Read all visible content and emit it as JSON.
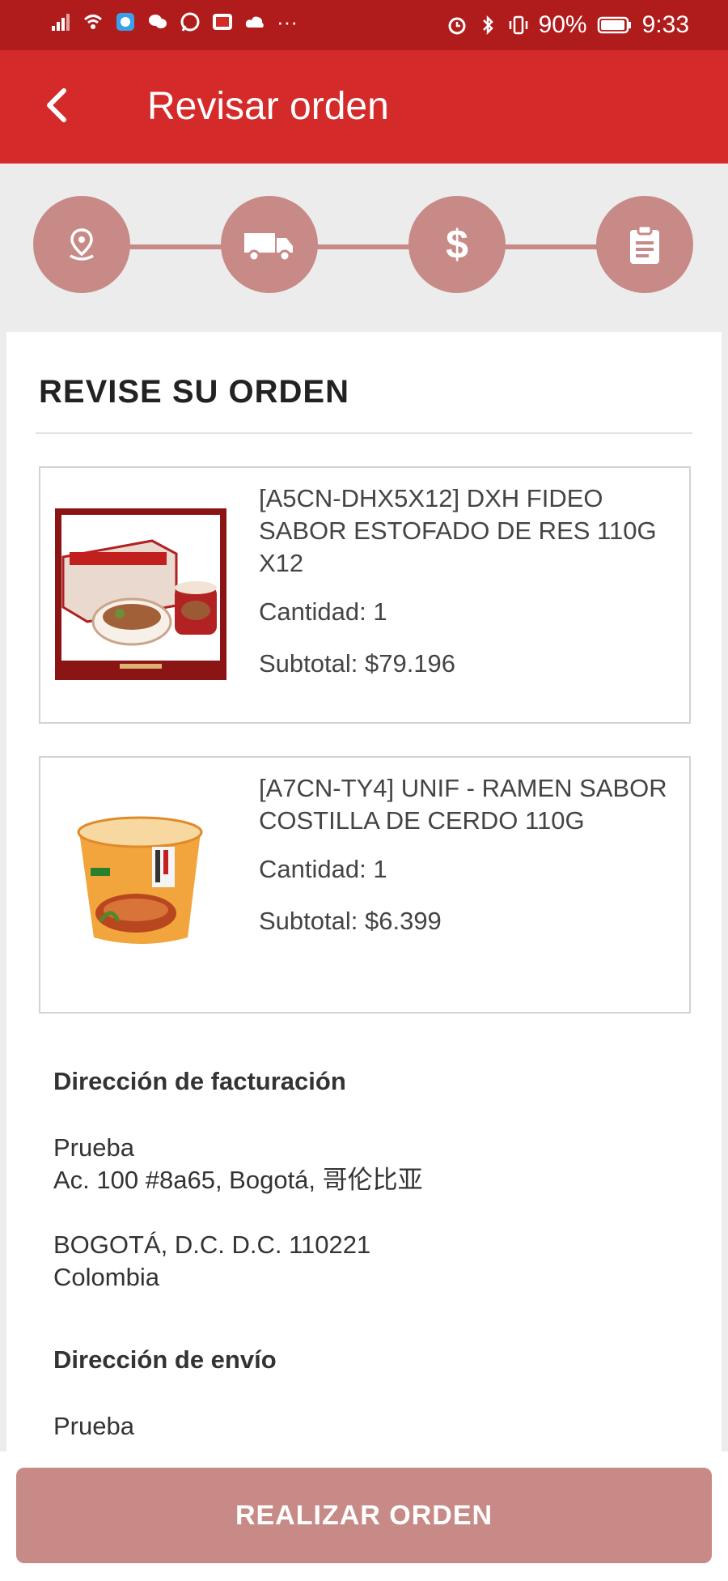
{
  "status_bar": {
    "battery": "90%",
    "time": "9:33"
  },
  "app_bar": {
    "title": "Revisar orden"
  },
  "stepper": {
    "steps": [
      {
        "icon": "location-pin-icon"
      },
      {
        "icon": "truck-icon"
      },
      {
        "icon": "dollar-icon"
      },
      {
        "icon": "clipboard-icon"
      }
    ]
  },
  "review": {
    "title": "REVISE SU ORDEN",
    "items": [
      {
        "name": "[A5CN-DHX5X12] DXH FIDEO SABOR ESTOFADO DE RES 110G X12",
        "quantity": "Cantidad: 1",
        "subtotal": "Subtotal: $79.196"
      },
      {
        "name": "[A7CN-TY4] UNIF - RAMEN SABOR COSTILLA DE CERDO 110G",
        "quantity": "Cantidad: 1",
        "subtotal": "Subtotal: $6.399"
      }
    ]
  },
  "billing": {
    "heading": "Dirección de facturación",
    "name": "Prueba",
    "street": "Ac. 100 #8a65, Bogotá, 哥伦比亚",
    "city": "BOGOTÁ, D.C. D.C. 110221",
    "country": "Colombia"
  },
  "shipping": {
    "heading": "Dirección de envío",
    "name": "Prueba"
  },
  "actions": {
    "place_order": "REALIZAR ORDEN"
  },
  "colors": {
    "brand_red": "#d42a2a",
    "status_red": "#b01c1c",
    "muted_red": "#c78a87"
  }
}
